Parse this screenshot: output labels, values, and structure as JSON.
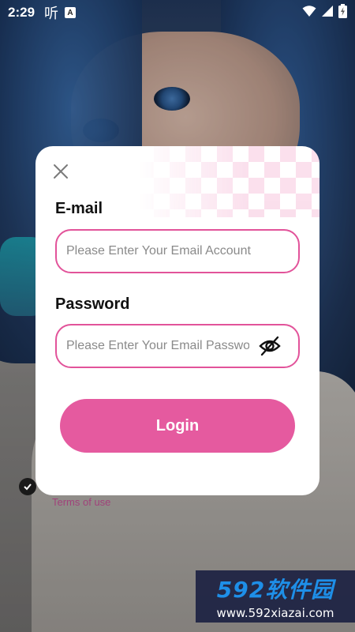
{
  "status_bar": {
    "time": "2:29",
    "listen_glyph": "听",
    "a_badge": "A",
    "icons": [
      "wifi-icon",
      "signal-icon",
      "battery-icon"
    ]
  },
  "background": {
    "terms_text": "Terms of use"
  },
  "login_dialog": {
    "close_icon": "close-icon",
    "email_label": "E-mail",
    "email_placeholder": "Please Enter Your Email Account",
    "email_value": "",
    "password_label": "Password",
    "password_placeholder": "Please Enter Your Email Password",
    "password_value": "",
    "visibility_icon": "eye-off-icon",
    "login_button": "Login"
  },
  "watermark": {
    "brand": "592软件园",
    "url": "www.592xiazai.com"
  },
  "colors": {
    "accent": "#e55a9f",
    "field_border": "#e2539a",
    "checker_pink": "#f7c6de",
    "watermark_bg": "#1c2242",
    "watermark_brand": "#1e8fe8"
  }
}
